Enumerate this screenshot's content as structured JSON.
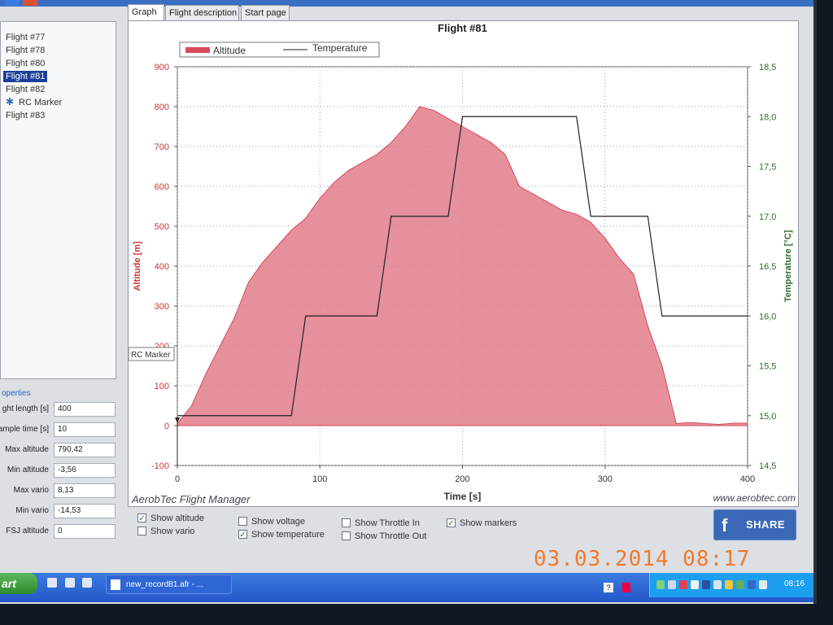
{
  "tree": {
    "items": [
      {
        "label": "Flight #77"
      },
      {
        "label": "Flight #78"
      },
      {
        "label": "Flight #80"
      },
      {
        "label": "Flight #81"
      },
      {
        "label": "Flight #82"
      },
      {
        "label": "RC Marker"
      },
      {
        "label": "Flight #83"
      }
    ],
    "selected_label": "Flight #81"
  },
  "properties": {
    "title": "operties",
    "rows": [
      {
        "label": "ght length [s]",
        "value": "400"
      },
      {
        "label": "ample time [s]",
        "value": "10"
      },
      {
        "label": "Max altitude",
        "value": "790,42"
      },
      {
        "label": "Min altitude",
        "value": "-3,56"
      },
      {
        "label": "Max vario",
        "value": "8,13"
      },
      {
        "label": "Min vario",
        "value": "-14,53"
      },
      {
        "label": "FSJ altitude",
        "value": "0"
      }
    ]
  },
  "tabs": [
    {
      "label": "Graph"
    },
    {
      "label": "Flight description"
    },
    {
      "label": "Start page"
    }
  ],
  "graph": {
    "footer_left": "AerobTec Flight Manager",
    "footer_right": "www.aerobtec.com",
    "marker_label": "RC Marker"
  },
  "options": [
    {
      "label": "Show altitude",
      "checked": true
    },
    {
      "label": "Show vario",
      "checked": false
    },
    {
      "label": "Show voltage",
      "checked": false
    },
    {
      "label": "Show temperature",
      "checked": true
    },
    {
      "label": "Show Throttle In",
      "checked": false
    },
    {
      "label": "Show Throttle Out",
      "checked": false
    },
    {
      "label": "Show markers",
      "checked": true
    }
  ],
  "share": {
    "label": "SHARE",
    "icon": "facebook-f-icon"
  },
  "taskbar": {
    "start_label": "art",
    "task_label": "new_record81.afr - ...",
    "clock": "08:16"
  },
  "camera_date_stamp": "03.03.2014  08:17",
  "colors": {
    "altitude": "#d84a5a",
    "altitude_fill": "#e07d8a",
    "temperature": "#222222",
    "left_axis": "#cc3333",
    "right_axis": "#2e6b2e",
    "accent": "#1c3f9a"
  },
  "chart_data": {
    "type": "area",
    "title": "Flight #81",
    "xlabel": "Time [s]",
    "ylabel": "Altitude [m]",
    "ylabel_right": "Temperature [°C]",
    "xlim": [
      0,
      400
    ],
    "ylim": [
      -100,
      900
    ],
    "ylim_right": [
      14.5,
      18.5
    ],
    "x_ticks": [
      "0",
      "100",
      "200",
      "300",
      "400"
    ],
    "y_ticks": [
      "-100",
      "0",
      "100",
      "200",
      "300",
      "400",
      "500",
      "600",
      "700",
      "800",
      "900"
    ],
    "y_right_ticks": [
      "14,5",
      "15,0",
      "15,5",
      "16,0",
      "16,5",
      "17,0",
      "17,5",
      "18,0",
      "18,5"
    ],
    "grid": true,
    "legend_position": "top-left",
    "series": [
      {
        "name": "Altitude",
        "kind": "area",
        "x": [
          0,
          10,
          20,
          30,
          40,
          50,
          60,
          70,
          80,
          90,
          100,
          110,
          120,
          130,
          140,
          150,
          160,
          170,
          180,
          190,
          200,
          210,
          220,
          230,
          240,
          250,
          260,
          270,
          280,
          290,
          300,
          310,
          320,
          330,
          340,
          350,
          360,
          370,
          380,
          390,
          400
        ],
        "values": [
          5,
          50,
          130,
          200,
          270,
          360,
          410,
          450,
          490,
          520,
          570,
          610,
          640,
          660,
          680,
          710,
          750,
          800,
          790,
          770,
          750,
          730,
          710,
          680,
          600,
          580,
          560,
          540,
          530,
          510,
          470,
          420,
          380,
          250,
          150,
          5,
          8,
          5,
          3,
          6,
          6
        ]
      },
      {
        "name": "Temperature",
        "kind": "step",
        "x": [
          0,
          80,
          80,
          90,
          90,
          140,
          140,
          150,
          150,
          190,
          190,
          200,
          200,
          280,
          280,
          290,
          290,
          330,
          330,
          340,
          340,
          400
        ],
        "values": [
          15.0,
          15.0,
          15.0,
          16.0,
          16.0,
          16.0,
          16.0,
          17.0,
          17.0,
          17.0,
          17.0,
          18.0,
          18.0,
          18.0,
          18.0,
          17.0,
          17.0,
          17.0,
          17.0,
          16.0,
          16.0,
          16.0
        ]
      }
    ]
  }
}
